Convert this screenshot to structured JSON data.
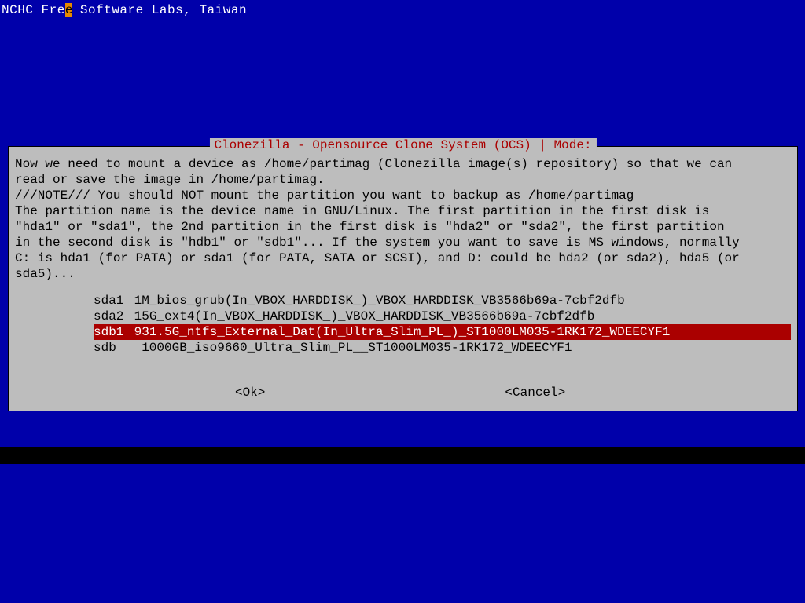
{
  "header": {
    "pre": "NCHC Fre",
    "cursor": "e",
    "post": " Software Labs, Taiwan"
  },
  "dialog": {
    "title": "Clonezilla - Opensource Clone System (OCS) | Mode:",
    "body": "Now we need to mount a device as /home/partimag (Clonezilla image(s) repository) so that we can\nread or save the image in /home/partimag.\n///NOTE/// You should NOT mount the partition you want to backup as /home/partimag\nThe partition name is the device name in GNU/Linux. The first partition in the first disk is\n\"hda1\" or \"sda1\", the 2nd partition in the first disk is \"hda2\" or \"sda2\", the first partition\nin the second disk is \"hdb1\" or \"sdb1\"... If the system you want to save is MS windows, normally\nC: is hda1 (for PATA) or sda1 (for PATA, SATA or SCSI), and D: could be hda2 (or sda2), hda5 (or\nsda5)..."
  },
  "options": [
    {
      "dev": "sda1",
      "desc": "1M_bios_grub(In_VBOX_HARDDISK_)_VBOX_HARDDISK_VB3566b69a-7cbf2dfb",
      "selected": false
    },
    {
      "dev": "sda2",
      "desc": "15G_ext4(In_VBOX_HARDDISK_)_VBOX_HARDDISK_VB3566b69a-7cbf2dfb",
      "selected": false
    },
    {
      "dev": "sdb1",
      "desc": "931.5G_ntfs_External_Dat(In_Ultra_Slim_PL_)_ST1000LM035-1RK172_WDEECYF1",
      "selected": true
    },
    {
      "dev": "sdb",
      "desc": "1000GB_iso9660_Ultra_Slim_PL__ST1000LM035-1RK172_WDEECYF1",
      "selected": false
    }
  ],
  "buttons": {
    "ok": "<Ok>",
    "cancel": "<Cancel>"
  }
}
